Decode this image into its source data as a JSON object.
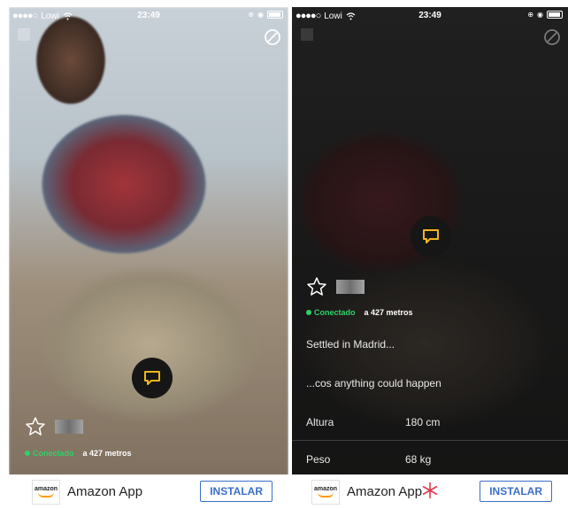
{
  "status_bar": {
    "carrier": "Lowi",
    "time": "23:49"
  },
  "profile_left": {
    "online_label": "Conectado",
    "distance": "a 427 metros"
  },
  "profile_right": {
    "online_label": "Conectado",
    "distance": "a 427 metros",
    "bio_line_1": "Settled in Madrid...",
    "bio_line_2": "...cos anything could happen",
    "stats": [
      {
        "label": "Altura",
        "value": "180 cm"
      },
      {
        "label": "Peso",
        "value": "68 kg"
      }
    ]
  },
  "ad": {
    "logo_text": "amazon",
    "title": "Amazon App",
    "install_label": "INSTALAR"
  },
  "colors": {
    "online_green": "#2fd06a",
    "chat_icon_yellow": "#f0b51d",
    "install_blue": "#3a6fc9"
  },
  "icons": [
    "wifi-icon",
    "block-icon",
    "chat-icon",
    "star-icon",
    "battery-icon"
  ]
}
